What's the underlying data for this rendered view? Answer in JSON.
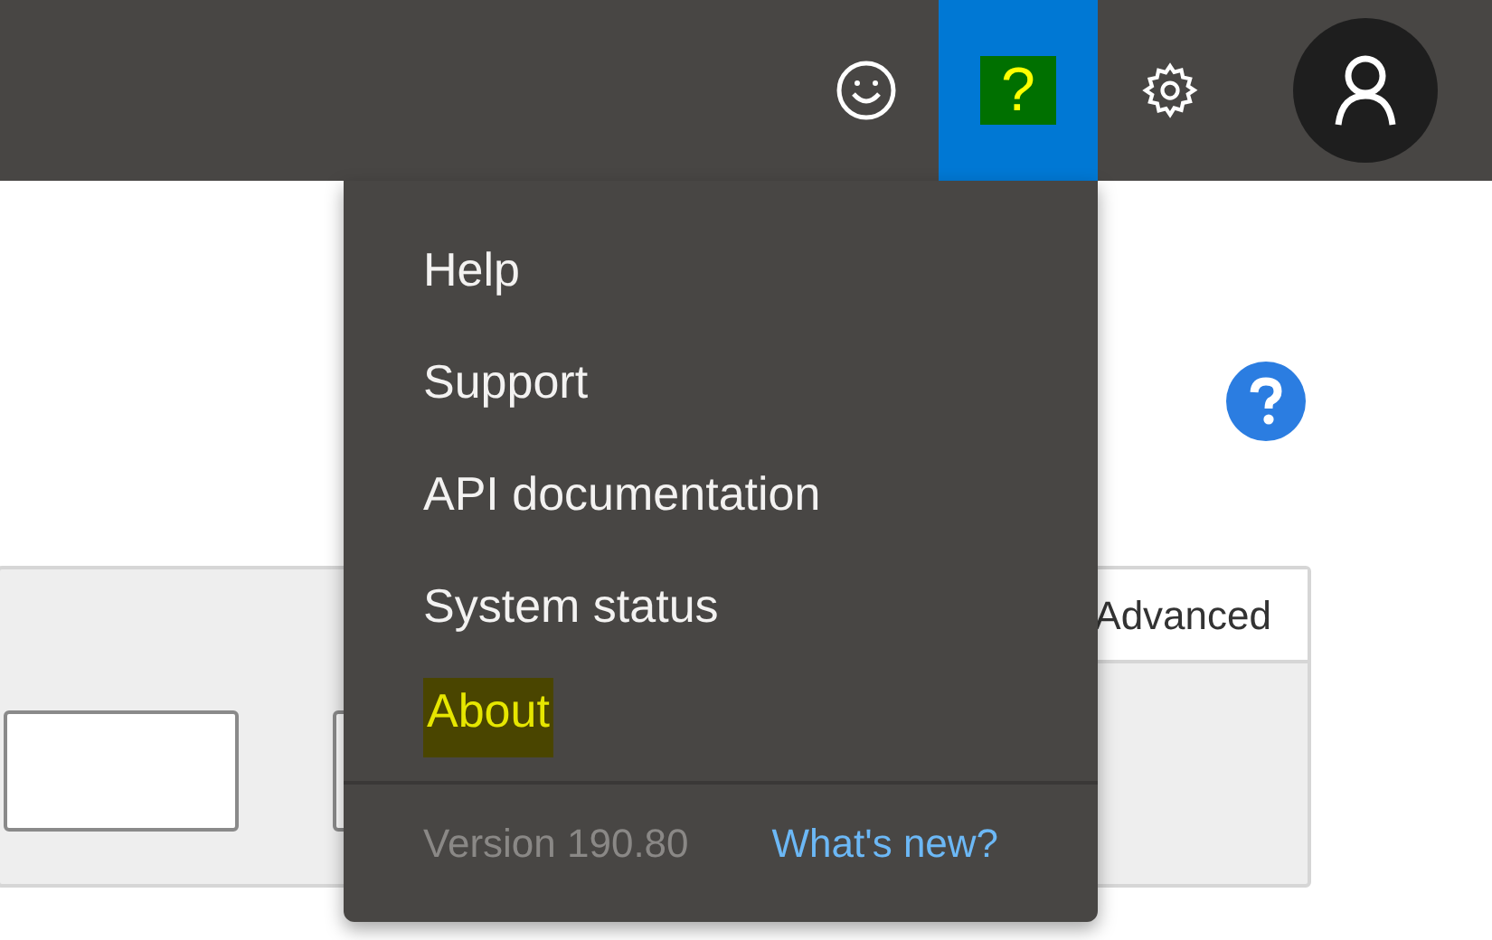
{
  "top_bar": {
    "buttons": [
      {
        "kind": "feedback",
        "selected": false
      },
      {
        "kind": "help",
        "label": "?",
        "selected": true
      },
      {
        "kind": "settings",
        "selected": false
      }
    ]
  },
  "help_menu": {
    "items": [
      {
        "label": "Help",
        "highlighted": false
      },
      {
        "label": "Support",
        "highlighted": false
      },
      {
        "label": "API documentation",
        "highlighted": false
      },
      {
        "label": "System status",
        "highlighted": false
      },
      {
        "label": "About",
        "highlighted": true
      }
    ],
    "version": "Version 190.80",
    "whats_new": "What's new?"
  },
  "panel": {
    "tab": "Advanced"
  }
}
